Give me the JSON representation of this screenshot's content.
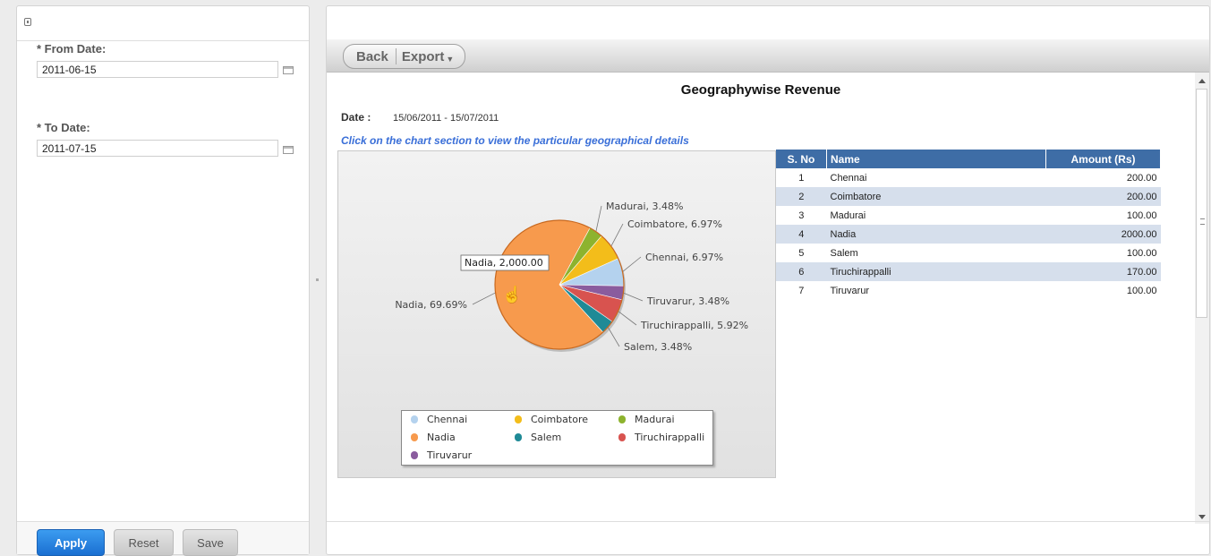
{
  "sidebar": {
    "from_date_label": "* From Date:",
    "from_date_value": "2011-06-15",
    "to_date_label": "* To Date:",
    "to_date_value": "2011-07-15",
    "apply_label": "Apply",
    "reset_label": "Reset",
    "save_label": "Save"
  },
  "toolbar": {
    "back_label": "Back",
    "export_label": "Export"
  },
  "report": {
    "title": "Geographywise Revenue",
    "date_label": "Date :",
    "date_range": "15/06/2011 - 15/07/2011",
    "instruction": "Click on the chart section  to view the particular geographical details",
    "tooltip": "Nadia, 2,000.00"
  },
  "table": {
    "headers": [
      "S. No",
      "Name",
      "Amount (Rs)"
    ],
    "rows": [
      {
        "sno": "1",
        "name": "Chennai",
        "amount": "200.00"
      },
      {
        "sno": "2",
        "name": "Coimbatore",
        "amount": "200.00"
      },
      {
        "sno": "3",
        "name": "Madurai",
        "amount": "100.00"
      },
      {
        "sno": "4",
        "name": "Nadia",
        "amount": "2000.00"
      },
      {
        "sno": "5",
        "name": "Salem",
        "amount": "100.00"
      },
      {
        "sno": "6",
        "name": "Tiruchirappalli",
        "amount": "170.00"
      },
      {
        "sno": "7",
        "name": "Tiruvarur",
        "amount": "100.00"
      }
    ]
  },
  "chart_data": {
    "type": "pie",
    "slices": [
      {
        "name": "Chennai",
        "value": 200,
        "label": "Chennai, 6.97%",
        "color": "#b4d2ee"
      },
      {
        "name": "Tiruvarur",
        "value": 100,
        "label": "Tiruvarur, 3.48%",
        "color": "#8a5c9e"
      },
      {
        "name": "Tiruchirappalli",
        "value": 170,
        "label": "Tiruchirappalli, 5.92%",
        "color": "#d8534f"
      },
      {
        "name": "Salem",
        "value": 100,
        "label": "Salem, 3.48%",
        "color": "#1f8a96"
      },
      {
        "name": "Nadia",
        "value": 2000,
        "label": "Nadia, 69.69%",
        "color": "#f79a4d"
      },
      {
        "name": "Madurai",
        "value": 100,
        "label": "Madurai, 3.48%",
        "color": "#8db32e"
      },
      {
        "name": "Coimbatore",
        "value": 200,
        "label": "Coimbatore, 6.97%",
        "color": "#f3bd1a"
      }
    ],
    "legend": [
      "Chennai",
      "Coimbatore",
      "Madurai",
      "Nadia",
      "Salem",
      "Tiruchirappalli",
      "Tiruvarur"
    ],
    "legend_placement": "bottom"
  }
}
